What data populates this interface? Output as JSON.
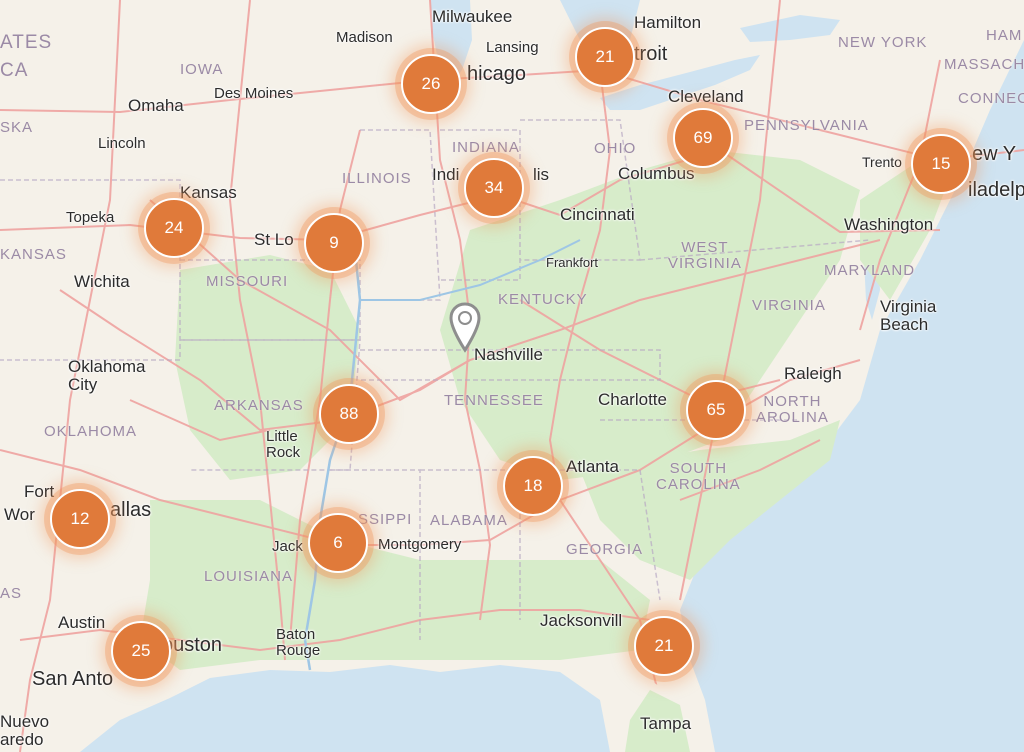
{
  "map": {
    "colors": {
      "water": "#cfe3f1",
      "land": "#f5f1e9",
      "green": "#d7ecca",
      "roads": "#efa3a0",
      "cluster": "#e07a3a",
      "state_label": "#9b8aa6"
    },
    "clusters": [
      {
        "id": "chicago",
        "count": "26"
      },
      {
        "id": "detroit",
        "count": "21"
      },
      {
        "id": "cleveland",
        "count": "69"
      },
      {
        "id": "philadelphia",
        "count": "15"
      },
      {
        "id": "indianapolis",
        "count": "34"
      },
      {
        "id": "kansas-city",
        "count": "24"
      },
      {
        "id": "st-louis",
        "count": "9"
      },
      {
        "id": "arkansas",
        "count": "88"
      },
      {
        "id": "charlotte",
        "count": "65"
      },
      {
        "id": "atlanta",
        "count": "18"
      },
      {
        "id": "dallas",
        "count": "12"
      },
      {
        "id": "jackson",
        "count": "6"
      },
      {
        "id": "houston",
        "count": "25"
      },
      {
        "id": "jacksonville",
        "count": "21"
      }
    ],
    "selected_marker": {
      "icon": "map-pin-icon",
      "city": "Nashville"
    },
    "cities": {
      "milwaukee": "Milwaukee",
      "hamilton": "Hamilton",
      "madison": "Madison",
      "lansing": "Lansing",
      "chicago": "hicago",
      "detroit": "troit",
      "omaha": "Omaha",
      "des_moines": "Des Moines",
      "lincoln": "Lincoln",
      "cleveland": "Cleveland",
      "new_york_city": "ew Y",
      "trenton": "Trento",
      "philadelphia": "iladelp",
      "indianapolis": "Indi",
      "indianapolis_end": "lis",
      "columbus": "Columbus",
      "kansas_city": "Kansas",
      "topeka": "Topeka",
      "st_louis": "St Lo",
      "cincinnati": "Cincinnati",
      "washington": "Washington",
      "frankfort": "Frankfort",
      "wichita": "Wichita",
      "virginia_beach": "Virginia\nBeach",
      "nashville": "Nashville",
      "oklahoma_city": "Oklahoma\nCity",
      "raleigh": "Raleigh",
      "charlotte": "Charlotte",
      "little_rock": "Little\nRock",
      "atlanta": "Atlanta",
      "fort_worth_1": "Fort",
      "fort_worth_2": "Wor",
      "dallas": "allas",
      "jackson": "Jack",
      "montgomery": "Montgomery",
      "austin": "Austin",
      "houston": "ouston",
      "baton_rouge": "Baton\nRouge",
      "jacksonville": "Jacksonvill",
      "san_antonio": "San Anto",
      "tampa": "Tampa",
      "nuevo_laredo": "Nuevo\naredo"
    },
    "states": {
      "states_edge": "ATES",
      "ca_edge": "CA",
      "iowa": "IOWA",
      "ska_edge": "SKA",
      "illinois": "ILLINOIS",
      "indiana": "INDIANA",
      "ohio": "OHIO",
      "new_york": "NEW YORK",
      "massachusetts": "MASSACH",
      "ham": "HAM",
      "connecticut": "CONNEC",
      "pennsylvania": "PENNSYLVANIA",
      "kansas": "KANSAS",
      "missouri": "MISSOURI",
      "west_virginia": "WEST\nVIRGINIA",
      "maryland": "MARYLAND",
      "kentucky": "KENTUCKY",
      "virginia": "VIRGINIA",
      "arkansas": "ARKANSAS",
      "tennessee": "TENNESSEE",
      "north_carolina": "NORTH\nAROLINA",
      "oklahoma": "OKLAHOMA",
      "south_carolina": "SOUTH\nCAROLINA",
      "mississippi": "SSIPPI",
      "alabama": "ALABAMA",
      "georgia": "GEORGIA",
      "louisiana": "LOUISIANA",
      "as_edge": "AS"
    }
  }
}
